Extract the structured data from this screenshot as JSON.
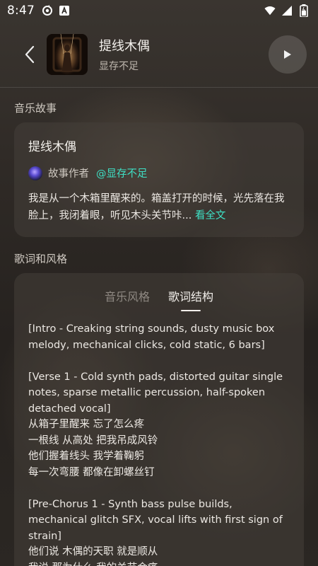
{
  "status_bar": {
    "time": "8:47",
    "left_icons": [
      "sync-icon",
      "app-a-icon"
    ],
    "right_icons": [
      "wifi-icon",
      "signal-icon",
      "battery-icon"
    ]
  },
  "header": {
    "title": "提线木偶",
    "artist": "显存不足"
  },
  "story_section": {
    "title": "音乐故事",
    "card": {
      "title": "提线木偶",
      "author_label": "故事作者",
      "author_handle": "@显存不足",
      "text": "我是从一个木箱里醒来的。箱盖打开的时候，光先落在我脸上，我闭着眼，听见木头关节咔...",
      "read_more": "看全文"
    }
  },
  "lyrics_section": {
    "title": "歌词和风格",
    "tabs": [
      {
        "label": "音乐风格",
        "active": false
      },
      {
        "label": "歌词结构",
        "active": true
      }
    ],
    "lines": [
      "[Intro - Creaking string sounds, dusty music box melody, mechanical clicks, cold static, 6 bars]",
      "",
      "[Verse 1 - Cold synth pads, distorted guitar single notes, sparse metallic percussion, half-spoken detached vocal]",
      "从箱子里醒来 忘了怎么疼",
      "一根线 从高处 把我吊成风铃",
      "他们握着线头 我学着鞠躬",
      "每一次弯腰 都像在卸螺丝钉",
      "",
      "[Pre-Chorus 1 - Synth bass pulse builds, mechanical glitch SFX, vocal lifts with first sign of strain]",
      "他们说 木偶的天职 就是顺从",
      "我说 那为什么 我的关节会痛"
    ]
  },
  "colors": {
    "accent": "#3ee0c5",
    "background": "#2a2622",
    "card": "#46403a"
  }
}
